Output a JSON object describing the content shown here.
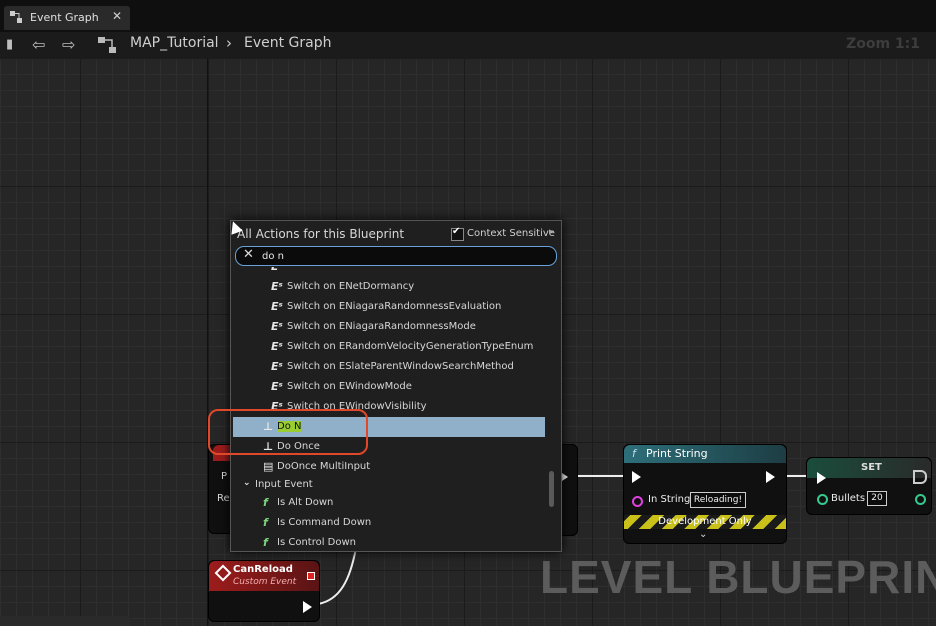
{
  "tab": {
    "label": "Event Graph",
    "close": "✕"
  },
  "toolbar": {
    "breadcrumb": [
      "MAP_Tutorial",
      "Event Graph"
    ],
    "separator": "›",
    "zoom": "Zoom 1:1"
  },
  "menu": {
    "title": "All Actions for this Blueprint",
    "context_label": "Context Sensitive",
    "context_checked": true,
    "search_value": "do n",
    "items": [
      {
        "label": "Switch on ENetDormancy",
        "icon": "switch-enum-icon",
        "selected": false
      },
      {
        "label": "Switch on ENiagaraRandomnessEvaluation",
        "icon": "switch-enum-icon",
        "selected": false
      },
      {
        "label": "Switch on ENiagaraRandomnessMode",
        "icon": "switch-enum-icon",
        "selected": false
      },
      {
        "label": "Switch on ERandomVelocityGenerationTypeEnum",
        "icon": "switch-enum-icon",
        "selected": false
      },
      {
        "label": "Switch on ESlateParentWindowSearchMethod",
        "icon": "switch-enum-icon",
        "selected": false
      },
      {
        "label": "Switch on EWindowMode",
        "icon": "switch-enum-icon",
        "selected": false
      },
      {
        "label": "Switch on EWindowVisibility",
        "icon": "switch-enum-icon",
        "selected": false
      },
      {
        "label": "Do N",
        "icon": "flow-control-icon",
        "selected": true
      },
      {
        "label": "Do Once",
        "icon": "flow-control-icon",
        "selected": false
      },
      {
        "label": "DoOnce MultiInput",
        "icon": "macro-icon",
        "selected": false
      }
    ],
    "category": "Input Event",
    "category_items": [
      "Is Alt Down",
      "Is Command Down",
      "Is Control Down"
    ]
  },
  "nodes": {
    "print_string": {
      "title": "Print String",
      "pin_label": "In String",
      "pin_value": "Reloading!",
      "footer": "Development Only"
    },
    "set": {
      "title": "SET",
      "pin_label": "Bullets",
      "pin_value": "20"
    },
    "can_reload": {
      "title": "CanReload",
      "subtitle": "Custom Event"
    },
    "left_partial": {
      "line1": "P",
      "line2": "Re"
    }
  },
  "watermark": "LEVEL BLUEPRINT",
  "colors": {
    "selection": "#8fb0c8",
    "match_highlight": "#9acd32",
    "annotation": "#e0482a"
  }
}
